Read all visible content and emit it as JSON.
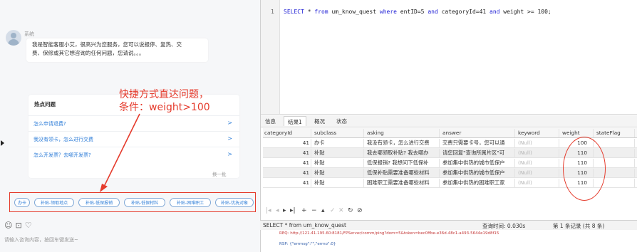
{
  "chat": {
    "sender": "系统",
    "greeting_line1": "我是智能客服小艾，很高兴为您服务，您可以说报停、复热、交",
    "greeting_line2": "费、保修或其它想咨询的任何问题，您请说。。。",
    "hot_title": "热点问题",
    "hot_questions": [
      "怎么申请退费?",
      "我没有领卡，怎么进行交费",
      "怎么开发票？去哪开发票?"
    ],
    "arrow_glyph": ">",
    "refresh_label": "换一批",
    "annotation_line1": "快捷方式直达问题，",
    "annotation_line2": "条件：weight>100",
    "quick_buttons": [
      "办卡",
      "补贴-领取地点",
      "补贴-低保报销",
      "补贴-低保材料",
      "补贴-困难职工",
      "补贴-优抚对象"
    ],
    "input_placeholder": "请输入咨询内容，按回车键发送~",
    "tool_icons": [
      "emoji-icon",
      "image-icon",
      "heart-icon"
    ]
  },
  "sql": {
    "line_number": "1",
    "query_parts": [
      {
        "t": "SELECT",
        "kw": true
      },
      {
        "t": " * ",
        "kw": false
      },
      {
        "t": "from",
        "kw": true
      },
      {
        "t": " um_know_quest ",
        "kw": false
      },
      {
        "t": "where",
        "kw": true
      },
      {
        "t": " entID=5 ",
        "kw": false
      },
      {
        "t": "and",
        "kw": true
      },
      {
        "t": " categoryId=41 ",
        "kw": false
      },
      {
        "t": "and",
        "kw": true
      },
      {
        "t": " weight >= 100;",
        "kw": false
      }
    ],
    "tabs": [
      "信息",
      "结果1",
      "概况",
      "状态"
    ],
    "active_tab": 1,
    "columns": [
      "categoryId",
      "subclass",
      "asking",
      "answer",
      "keyword",
      "weight",
      "stateFlag"
    ],
    "rows": [
      [
        "41",
        "办卡",
        "我没有领卡，怎么进行交费",
        "交费只需要卡号，您可以通",
        "(Null)",
        "100",
        ""
      ],
      [
        "41",
        "补贴",
        "我去哪领取补贴? 我去哪办",
        "请您回复\"查询所属片区\"可",
        "(Null)",
        "110",
        ""
      ],
      [
        "41",
        "补贴",
        "低保报销? 我想问下低保补",
        "参加集中供热的城市低保户",
        "(Null)",
        "110",
        ""
      ],
      [
        "41",
        "补贴",
        "低保补贴需要准备哪些材料",
        "参加集中供热的城市低保户",
        "(Null)",
        "110",
        ""
      ],
      [
        "41",
        "补贴",
        "困难职工需要准备哪些材料",
        "参加集中供热的困难职工家",
        "(Null)",
        "110",
        ""
      ]
    ],
    "status_query": "SELECT * from um_know_quest",
    "status_time": "查询时间: 0.030s",
    "status_records": "第 1 条记录 (共 8 条)",
    "log_req": "REQ: http://121.41.195.60:8181/FPServer/comm/ping?dom=5&token=bec0ffbe-e36d-48c1-a493-5644e19d8f15",
    "log_rsp": "RSP: {\"errmsg\":\"\",\"errno\":0}",
    "accent_red": "#e53b2c",
    "link_blue": "#2f7ed8"
  }
}
